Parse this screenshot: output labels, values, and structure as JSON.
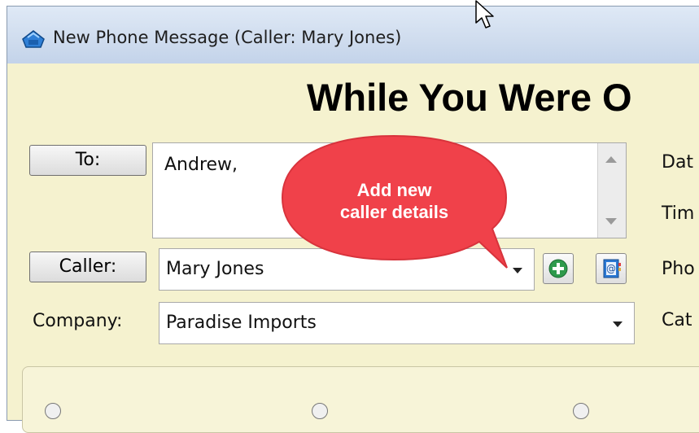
{
  "window": {
    "title": "New Phone Message (Caller: Mary Jones)",
    "heading": "While You Were O"
  },
  "form": {
    "to_button": "To:",
    "to_value": "Andrew,",
    "caller_button": "Caller:",
    "caller_value": "Mary Jones",
    "company_label": "Company:",
    "company_value": "Paradise Imports"
  },
  "right_labels": {
    "date": "Dat",
    "time": "Tim",
    "phone": "Pho",
    "category": "Cat"
  },
  "callout": {
    "line1": "Add new",
    "line2": "caller details",
    "color": "#f0414a"
  },
  "icons": {
    "app": "phone-icon",
    "add": "add-caller-icon",
    "address_book": "address-book-icon",
    "cursor": "mouse-cursor-icon"
  }
}
